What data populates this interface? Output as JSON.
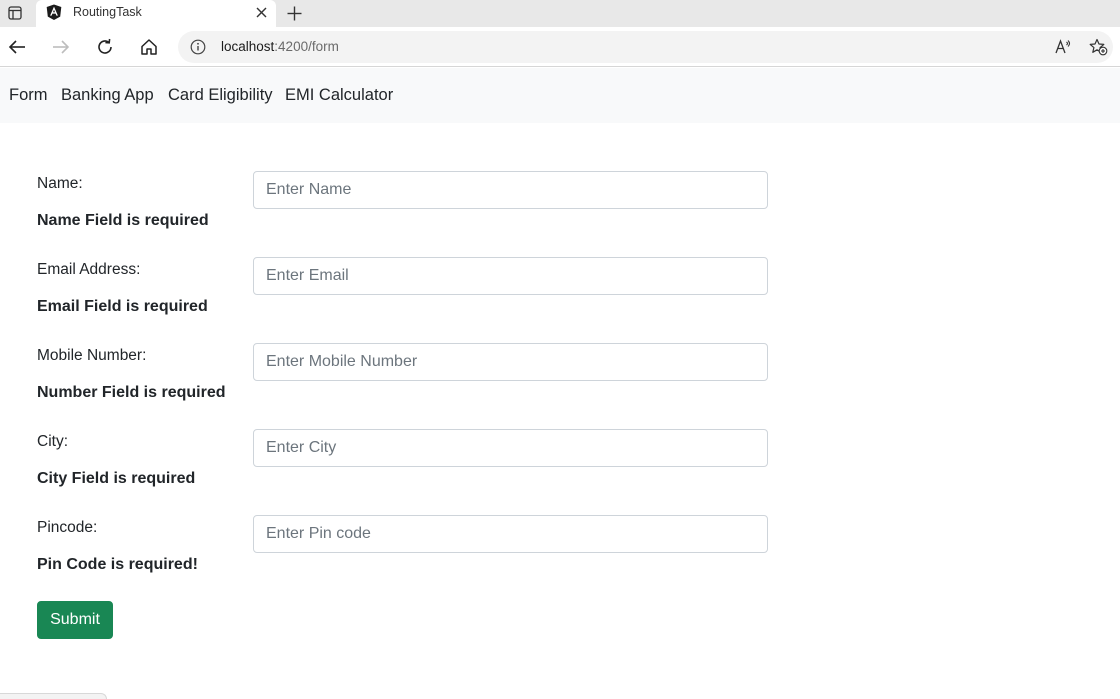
{
  "browser": {
    "tab_title": "RoutingTask",
    "url_host": "localhost",
    "url_path": ":4200/form",
    "icons": {
      "sidebar": "sidebar-toggle-icon",
      "favicon": "angular-logo-icon",
      "close": "close-icon",
      "new_tab": "plus-icon",
      "back": "back-arrow-icon",
      "forward": "forward-arrow-icon",
      "refresh": "refresh-icon",
      "home": "home-icon",
      "site_info": "info-icon",
      "read_aloud": "read-aloud-icon",
      "favorites": "add-favorite-icon"
    }
  },
  "nav": {
    "items": [
      "Form",
      "Banking App",
      "Card Eligibility",
      "EMI Calculator"
    ]
  },
  "form": {
    "fields": [
      {
        "label": "Name:",
        "placeholder": "Enter Name",
        "value": "",
        "error": "Name Field is required"
      },
      {
        "label": "Email Address:",
        "placeholder": "Enter Email",
        "value": "",
        "error": "Email Field is required"
      },
      {
        "label": "Mobile Number:",
        "placeholder": "Enter Mobile Number",
        "value": "",
        "error": "Number Field is required"
      },
      {
        "label": "City:",
        "placeholder": "Enter City",
        "value": "",
        "error": "City Field is required"
      },
      {
        "label": "Pincode:",
        "placeholder": "Enter Pin code",
        "value": "",
        "error": "Pin Code is required!"
      }
    ],
    "submit_label": "Submit"
  },
  "colors": {
    "submit_bg": "#198754",
    "navbar_bg": "#f8f9fa",
    "input_border": "#ced4da"
  }
}
